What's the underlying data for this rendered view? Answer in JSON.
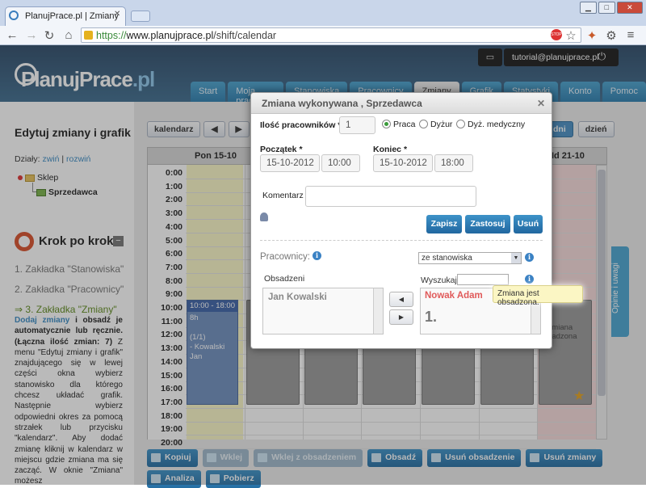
{
  "browser": {
    "tab_title": "PlanujPrace.pl | Zmiany",
    "url_scheme": "https://",
    "url_host": "www.planujprace.pl",
    "url_path": "/shift/calendar"
  },
  "header": {
    "logo_main": "PlanujPrace",
    "logo_tld": ".pl",
    "user": "tutorial@planujprace.pl",
    "nav": [
      "Start",
      "Moja praca",
      "Stanowiska",
      "Pracownicy",
      "Zmiany",
      "Grafik",
      "Statystyki",
      "Konto",
      "Pomoc"
    ],
    "active_tab": "Zmiany"
  },
  "sidebar": {
    "title": "Edytuj zmiany i grafik",
    "dzialy_label": "Działy:",
    "collapse": "zwiń",
    "expand": "rozwiń",
    "tree_root": "Sklep",
    "tree_child": "Sprzedawca",
    "steps_title": "Krok po kroku",
    "step1": "1. Zakładka \"Stanowiska\"",
    "step2": "2. Zakładka \"Pracownicy\"",
    "step3": "3. Zakładka \"Zmiany\"",
    "text_link": "Dodaj zmiany",
    "text_bold": "i obsadź je automatycznie lub ręcznie. (Łączna ilość zmian: 7)",
    "text_body": "Z menu \"Edytuj zmiany i grafik\" znajdującego się w lewej części okna wybierz stanowisko dla którego chcesz układać grafik. Następnie wybierz odpowiedni okres za pomocą strzałek lub przycisku \"kalendarz\". Aby dodać zmianę kliknij w kalendarz w miejscu gdzie zmiana ma się zacząć. W oknie \"Zmiana\" możesz"
  },
  "calendar": {
    "btn_calendar": "kalendarz",
    "btn_prev": "◀",
    "btn_next": "▶",
    "view_btns": [
      "dni",
      "dzień"
    ],
    "col_first": "Pon 15-10",
    "col_last": "Nd 21-10",
    "hours": [
      "0:00",
      "1:00",
      "2:00",
      "3:00",
      "4:00",
      "5:00",
      "6:00",
      "7:00",
      "8:00",
      "9:00",
      "10:00",
      "11:00",
      "12:00",
      "13:00",
      "14:00",
      "15:00",
      "16:00",
      "17:00",
      "18:00",
      "19:00",
      "20:00"
    ],
    "event_head": "10:00 - 18:00",
    "event_dur": "8h",
    "event_count": "(1/1)",
    "event_person": "- Kowalski Jan",
    "event_right": "1. zmiana obsadzona",
    "side_tab": "Opinie i uwagi"
  },
  "bottom_buttons": [
    "Kopiuj",
    "Wklej",
    "Wklej z obsadzeniem",
    "Obsadź",
    "Usuń obsadzenie",
    "Usuń zmiany"
  ],
  "bottom_buttons_row2": [
    "Analiza",
    "Pobierz"
  ],
  "modal": {
    "title": "Zmiana wykonywana , Sprzedawca",
    "count_label": "Ilość pracowników",
    "required": "*",
    "count_value": "1",
    "type_options": [
      "Praca",
      "Dyżur",
      "Dyż. medyczny"
    ],
    "selected_type": "Praca",
    "start_label": "Początek",
    "start_date": "15-10-2012",
    "start_time": "10:00",
    "end_label": "Koniec",
    "end_date": "15-10-2012",
    "end_time": "18:00",
    "comment_label": "Komentarz",
    "btn_save": "Zapisz",
    "btn_apply": "Zastosuj",
    "btn_delete": "Usuń",
    "workers_label": "Pracownicy:",
    "source_select": "ze stanowiska",
    "assigned_label": "Obsadzeni",
    "search_label": "Wyszukaj:",
    "assigned_list": [
      "Jan Kowalski"
    ],
    "available_name": "Nowak Adam",
    "available_number": "1.",
    "tooltip": "Zmiana jest obsadzona."
  },
  "colors": {
    "accent": "#2d7eaf",
    "header": "#3f6d8f",
    "highlight_name": "#e05a5a",
    "today_col": "#fbf6c4"
  }
}
